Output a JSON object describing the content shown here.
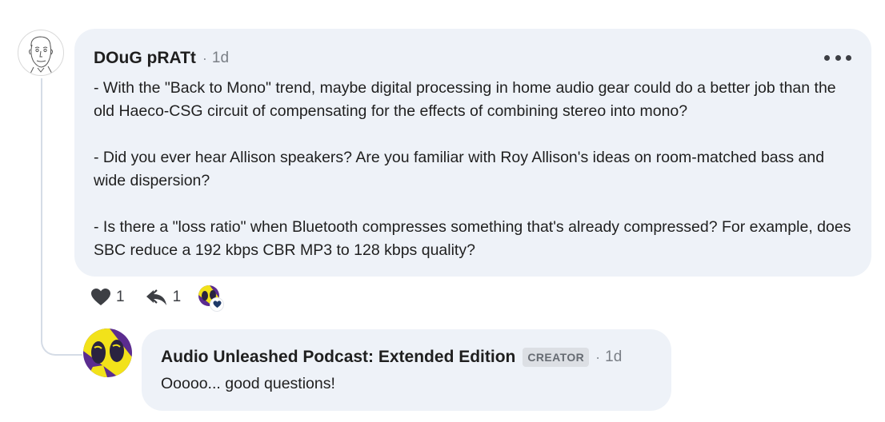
{
  "comment": {
    "author": "DOuG pRATt",
    "separator": "·",
    "time": "1d",
    "paragraphs": [
      "- With the \"Back to Mono\" trend, maybe digital processing in home audio gear could do a better job than the old Haeco-CSG circuit of compensating for the effects of combining stereo into mono?",
      "- Did you ever hear Allison speakers? Are you familiar with Roy Allison's ideas on room-matched bass and wide dispersion?",
      "- Is there a \"loss ratio\" when Bluetooth compresses something that's already compressed? For example, does SBC reduce a 192 kbps CBR MP3 to 128 kbps quality?"
    ],
    "like_count": "1",
    "reply_count": "1"
  },
  "reply": {
    "author": "Audio Unleashed Podcast: Extended Edition",
    "badge": "CREATOR",
    "separator": "·",
    "time": "1d",
    "text": "Ooooo... good questions!"
  },
  "icons": {
    "more": "more-horizontal-icon",
    "like": "heart-icon",
    "reply": "reply-icon",
    "reaction": "heart-icon"
  },
  "colors": {
    "bubble": "#eef2f8",
    "thread_line": "#d5dce6",
    "badge_bg": "#dcdfe4",
    "icon": "#3d3f44",
    "reaction_heart": "#1f3a68",
    "podcast_yellow": "#f2e21a",
    "podcast_purple": "#5b2c8f"
  }
}
